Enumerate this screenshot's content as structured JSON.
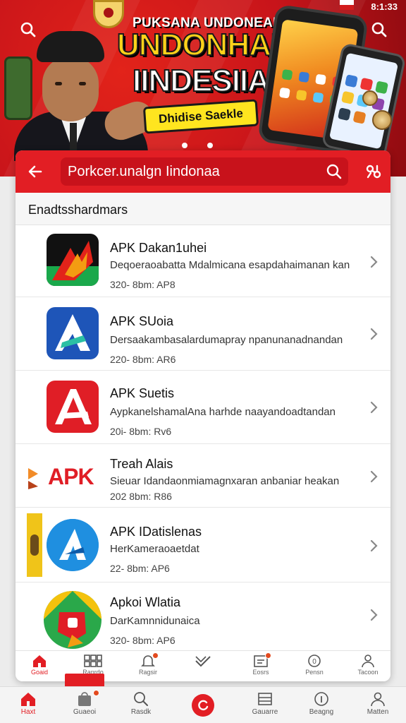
{
  "status": {
    "time": "8:1:33"
  },
  "banner": {
    "kicker": "PUKSANA UNDONEAIA",
    "title_line1": "UNDONHAM",
    "title_line2": "IINDESIIA!",
    "badge": "Dhidise Saekle"
  },
  "search": {
    "value": "Porkcer.unalgn Iindonaa"
  },
  "section": {
    "title": "Enadtsshardmars"
  },
  "apps": [
    {
      "title": "APK Dakan1uhei",
      "desc": "Deqoeraoabatta Mdalmicana esapdahaimanan kan",
      "meta": "320- 8bm: AP8"
    },
    {
      "title": "APK SUoia",
      "desc": "Dersaakambasalardumapray npanunanadnandan",
      "meta": "220- 8bm: AR6"
    },
    {
      "title": "APK Suetis",
      "desc": "AypkanelshamalAna harhde naayandoadtandan",
      "meta": "20i- 8bm: Rv6"
    },
    {
      "title": "Treah Alais",
      "desc": "Sieuar Idandaonmiamagnxaran anbaniar heakan",
      "meta": "202 8bm: R86",
      "icon_text": "APK"
    },
    {
      "title": "APK IDatislenas",
      "desc": "HerKameraoaetdat",
      "meta": "22- 8bm: AP6"
    },
    {
      "title": "Apkoi Wlatia",
      "desc": "DarKamnnidunaica",
      "meta": "320- 8bm: AP6"
    }
  ],
  "inner_nav": [
    {
      "label": "Goaid",
      "icon": "home-icon"
    },
    {
      "label": "Ranrdo",
      "icon": "grid-icon"
    },
    {
      "label": "Ragsir",
      "icon": "bell-icon"
    },
    {
      "label": "",
      "icon": "check-icon"
    },
    {
      "label": "Eosrs",
      "icon": "card-icon"
    },
    {
      "label": "Pensn",
      "icon": "clock-icon"
    },
    {
      "label": "Tacoon",
      "icon": "user-icon"
    }
  ],
  "bottom_nav": [
    {
      "label": "Haxt",
      "icon": "home-icon"
    },
    {
      "label": "Guaeoi",
      "icon": "bag-icon"
    },
    {
      "label": "Rasdk",
      "icon": "search-icon"
    },
    {
      "label": "Gauarre",
      "icon": "list-icon"
    },
    {
      "label": "Beagng",
      "icon": "info-icon"
    },
    {
      "label": "Matten",
      "icon": "user-icon"
    }
  ],
  "colors": {
    "brand_red": "#e21e24",
    "banner_red": "#c8141a",
    "badge_yellow": "#ffe51f"
  }
}
